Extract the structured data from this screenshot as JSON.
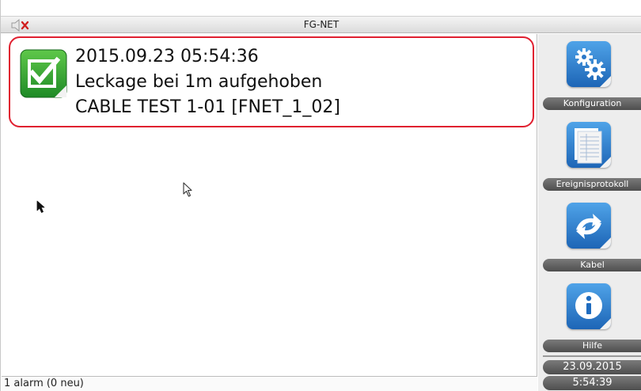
{
  "window": {
    "title": "FG-NET"
  },
  "alarm": {
    "timestamp": "2015.09.23 05:54:36",
    "message": "Leckage bei 1m aufgehoben",
    "cable": "CABLE TEST 1-01 [FNET_1_02]",
    "highlight_color": "#e02030",
    "icon": "checkmark-icon"
  },
  "status": {
    "text": "1 alarm (0 neu)"
  },
  "sidebar": {
    "buttons": [
      {
        "label": "Konfiguration",
        "icon": "gears-icon"
      },
      {
        "label": "Ereignisprotokoll",
        "icon": "log-icon"
      },
      {
        "label": "Kabel",
        "icon": "cable-arrows-icon"
      },
      {
        "label": "Hilfe",
        "icon": "info-icon"
      }
    ],
    "date": "23.09.2015",
    "time": "5:54:39"
  }
}
